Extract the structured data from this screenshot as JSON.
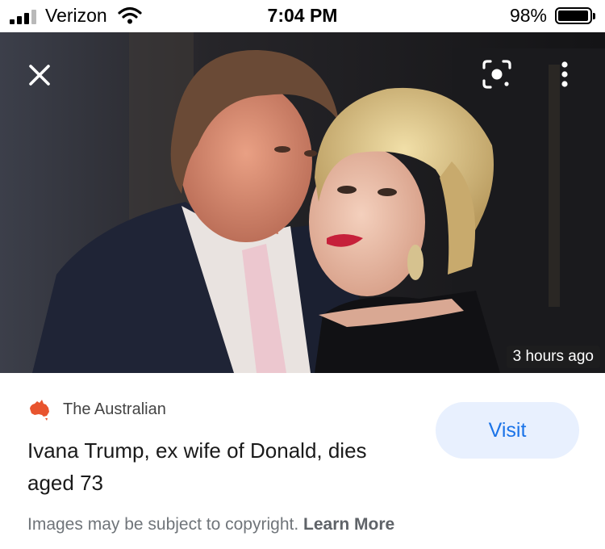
{
  "status_bar": {
    "carrier": "Verizon",
    "time": "7:04 PM",
    "battery": "98%",
    "signal_bars_filled": 3,
    "signal_bars_total": 4
  },
  "viewer": {
    "close_icon": "close-icon",
    "lens_icon": "google-lens-icon",
    "more_icon": "more-vertical-icon",
    "timestamp": "3 hours ago"
  },
  "result": {
    "source_name": "The Australian",
    "source_logo_color": "#e8542e",
    "headline": "Ivana Trump, ex wife of Donald, dies aged 73",
    "visit_label": "Visit",
    "copyright_text": "Images may be subject to copyright.",
    "learn_more_label": "Learn More"
  },
  "colors": {
    "accent": "#1a73e8",
    "visit_bg": "#e8f0fe"
  }
}
